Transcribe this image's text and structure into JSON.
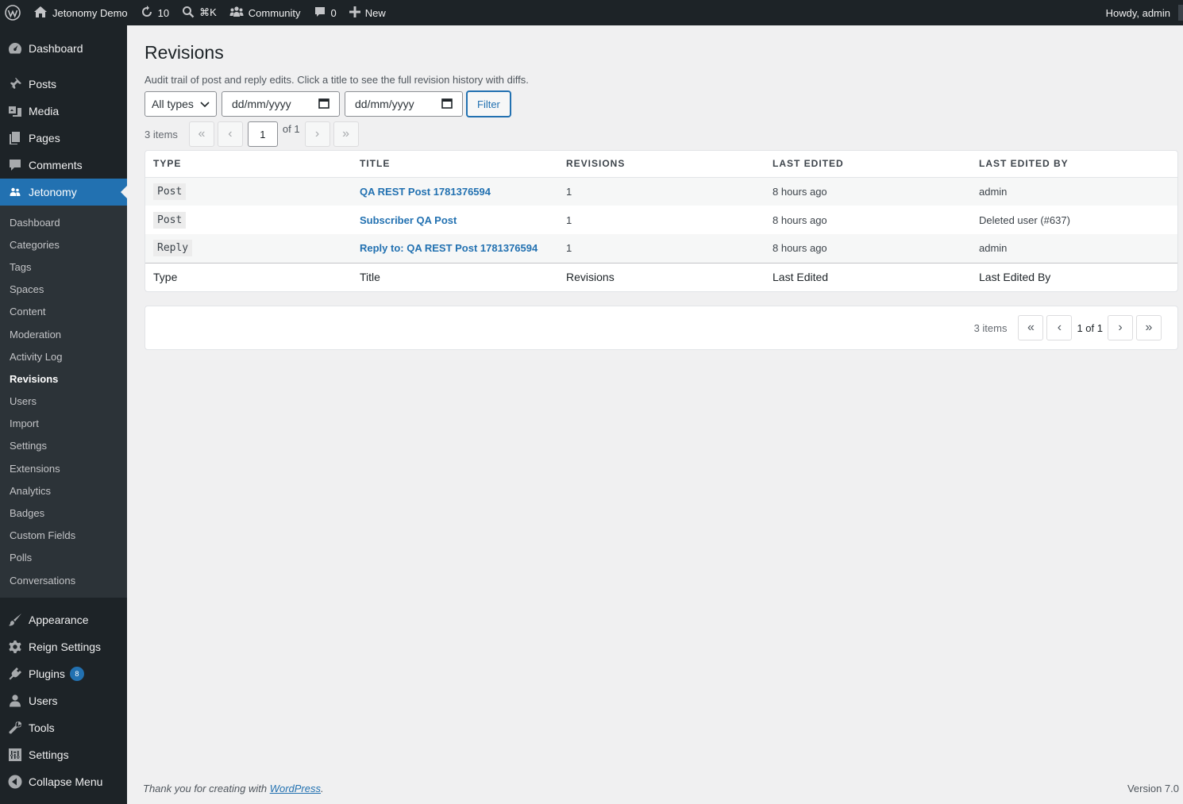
{
  "adminbar": {
    "site_name": "Jetonomy Demo",
    "updates_count": "10",
    "shortcut": "⌘K",
    "community": "Community",
    "comments_count": "0",
    "new_label": "New",
    "howdy": "Howdy, admin"
  },
  "sidebar": {
    "dashboard": "Dashboard",
    "posts": "Posts",
    "media": "Media",
    "pages": "Pages",
    "comments": "Comments",
    "jetonomy": "Jetonomy",
    "submenu": [
      "Dashboard",
      "Categories",
      "Tags",
      "Spaces",
      "Content",
      "Moderation",
      "Activity Log",
      "Revisions",
      "Users",
      "Import",
      "Settings",
      "Extensions",
      "Analytics",
      "Badges",
      "Custom Fields",
      "Polls",
      "Conversations"
    ],
    "appearance": "Appearance",
    "reign_settings": "Reign Settings",
    "plugins": "Plugins",
    "plugins_badge": "8",
    "users": "Users",
    "tools": "Tools",
    "settings": "Settings",
    "collapse": "Collapse Menu"
  },
  "page": {
    "title": "Revisions",
    "description": "Audit trail of post and reply edits. Click a title to see the full revision history with diffs."
  },
  "filters": {
    "type_select": "All types",
    "date_from_placeholder": "dd/mm/yyyy",
    "date_to_placeholder": "dd/mm/yyyy",
    "filter_button": "Filter"
  },
  "pager_top": {
    "items": "3 items",
    "first": "«",
    "prev": "‹",
    "current_page": "1",
    "of": "of 1",
    "next": "›",
    "last": "»"
  },
  "table": {
    "headers": [
      "TYPE",
      "TITLE",
      "REVISIONS",
      "LAST EDITED",
      "LAST EDITED BY"
    ],
    "rows": [
      {
        "type": "Post",
        "title": "QA REST Post 1781376594",
        "revisions": "1",
        "last_edited": "8 hours ago",
        "last_edited_by": "admin"
      },
      {
        "type": "Post",
        "title": "Subscriber QA Post",
        "revisions": "1",
        "last_edited": "8 hours ago",
        "last_edited_by": "Deleted user (#637)"
      },
      {
        "type": "Reply",
        "title": "Reply to: QA REST Post 1781376594",
        "revisions": "1",
        "last_edited": "8 hours ago",
        "last_edited_by": "admin"
      }
    ],
    "footers": [
      "Type",
      "Title",
      "Revisions",
      "Last Edited",
      "Last Edited By"
    ]
  },
  "pager_bottom": {
    "items": "3 items",
    "first": "«",
    "prev": "‹",
    "page_of": "1 of 1",
    "next": "›",
    "last": "»"
  },
  "footer": {
    "thanks_prefix": "Thank you for creating with ",
    "wp_link": "WordPress",
    "thanks_suffix": ".",
    "version": "Version 7.0"
  },
  "colors": {
    "admin_bar_bg": "#1d2327",
    "accent": "#2271b1",
    "page_bg": "#f0f0f1"
  }
}
